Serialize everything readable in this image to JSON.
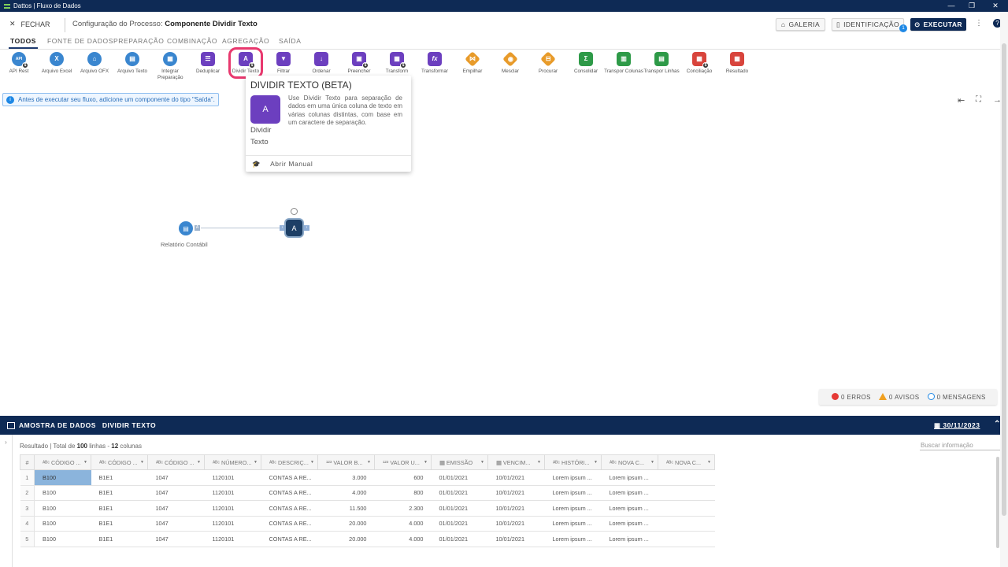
{
  "window": {
    "title": "Dattos | Fluxo de Dados",
    "minimize": "—",
    "restore": "❐",
    "close": "✕"
  },
  "header": {
    "close_label": "FECHAR",
    "process_label": "Configuração do Processo:",
    "process_name": "Componente Dividir Texto",
    "gallery": "GALERIA",
    "identification": "IDENTIFICAÇÃO",
    "identification_badge": "1",
    "execute": "EXECUTAR",
    "more": "⋮",
    "help": "?"
  },
  "tabs": [
    {
      "label": "TODOS",
      "active": true
    },
    {
      "label": "FONTE DE DADOS"
    },
    {
      "label": "PREPARAÇÃO"
    },
    {
      "label": "COMBINAÇÃO"
    },
    {
      "label": "AGREGAÇÃO"
    },
    {
      "label": "SAÍDA"
    }
  ],
  "tools": [
    {
      "label": "API Rest",
      "icon": "api-icon",
      "glyph": "API"
    },
    {
      "label": "Arquivo Excel",
      "icon": "excel-file-icon",
      "glyph": "X"
    },
    {
      "label": "Arquivo OFX",
      "icon": "bank-icon",
      "glyph": "⌂"
    },
    {
      "label": "Arquivo Texto",
      "icon": "text-file-icon",
      "glyph": "▤"
    },
    {
      "label": "Integrar Preparação",
      "icon": "integrate-icon",
      "glyph": "▦"
    },
    {
      "label": "Deduplicar",
      "icon": "dedupe-icon",
      "glyph": "☰"
    },
    {
      "label": "Dividir Texto",
      "icon": "split-text-icon",
      "glyph": "A"
    },
    {
      "label": "Filtrar",
      "icon": "filter-icon",
      "glyph": "▼"
    },
    {
      "label": "Ordenar",
      "icon": "sort-icon",
      "glyph": "↓"
    },
    {
      "label": "Preencher",
      "icon": "fill-icon",
      "glyph": "▣"
    },
    {
      "label": "Transform",
      "icon": "transform-icon",
      "glyph": "▦"
    },
    {
      "label": "Transformar",
      "icon": "function-icon",
      "glyph": "fx"
    },
    {
      "label": "Empilhar",
      "icon": "stack-icon",
      "glyph": "⋈"
    },
    {
      "label": "Mesclar",
      "icon": "merge-icon",
      "glyph": "◉"
    },
    {
      "label": "Procurar",
      "icon": "lookup-icon",
      "glyph": "⊟"
    },
    {
      "label": "Consolidar",
      "icon": "sum-icon",
      "glyph": "Σ"
    },
    {
      "label": "Transpor Colunas",
      "icon": "transpose-columns-icon",
      "glyph": "▥"
    },
    {
      "label": "Transpor Linhas",
      "icon": "transpose-rows-icon",
      "glyph": "▤"
    },
    {
      "label": "Conciliação",
      "icon": "reconcile-icon",
      "glyph": "▦"
    },
    {
      "label": "Resultado",
      "icon": "result-icon",
      "glyph": "▦"
    }
  ],
  "info_message": "Antes de executar seu fluxo, adicione um componente do tipo \"Saída\".",
  "tooltip": {
    "title": "DIVIDIR TEXTO (BETA)",
    "description": "Use Dividir Texto para separação de dados em uma única coluna de texto em várias colunas distintas, com base em um caractere de separação.",
    "name_line1": "Dividir",
    "name_line2": "Texto",
    "manual": "Abrir Manual"
  },
  "canvas": {
    "node_source_label": "Relatório Contábil",
    "port_a": "A",
    "port_in": "›",
    "port_out": "›"
  },
  "canvas_controls": {
    "collapse": "⇤",
    "fit": "⛶",
    "expand": "→"
  },
  "status": {
    "errors": "0 ERROS",
    "warnings": "0 AVISOS",
    "messages": "0 MENSAGENS"
  },
  "panel": {
    "title": "AMOSTRA DE DADOS",
    "subtitle": "DIVIDIR TEXTO",
    "date": "30/11/2023",
    "toggle": "⌃",
    "side_arrow": "›",
    "search_placeholder": "Buscar informação",
    "search_icon": "C"
  },
  "summary": {
    "prefix": "Resultado | Total de ",
    "rows": "100",
    "mid": " linhas - ",
    "cols": "12",
    "suffix": " colunas"
  },
  "table": {
    "headers": [
      "#",
      "ᴬᴮᶜ CÓDIGO ...",
      "ᴬᴮᶜ CÓDIGO ...",
      "ᴬᴮᶜ CÓDIGO ...",
      "ᴬᴮᶜ NÚMERO...",
      "ᴬᴮᶜ DESCRIÇ...",
      "¹²³ VALOR B...",
      "¹²³ VALOR U...",
      "▦ EMISSÃO",
      "▦ VENCIM...",
      "ᴬᴮᶜ HISTÓRI...",
      "ᴬᴮᶜ NOVA C...",
      "ᴬᴮᶜ NOVA C..."
    ],
    "rows": [
      [
        "1",
        "B100",
        "B1E1",
        "1047",
        "1120101",
        "CONTAS A RE...",
        "3.000",
        "600",
        "01/01/2021",
        "10/01/2021",
        "Lorem ipsum ...",
        "Lorem ipsum ...",
        ""
      ],
      [
        "2",
        "B100",
        "B1E1",
        "1047",
        "1120101",
        "CONTAS A RE...",
        "4.000",
        "800",
        "01/01/2021",
        "10/01/2021",
        "Lorem ipsum ...",
        "Lorem ipsum ...",
        ""
      ],
      [
        "3",
        "B100",
        "B1E1",
        "1047",
        "1120101",
        "CONTAS A RE...",
        "11.500",
        "2.300",
        "01/01/2021",
        "10/01/2021",
        "Lorem ipsum ...",
        "Lorem ipsum ...",
        ""
      ],
      [
        "4",
        "B100",
        "B1E1",
        "1047",
        "1120101",
        "CONTAS A RE...",
        "20.000",
        "4.000",
        "01/01/2021",
        "10/01/2021",
        "Lorem ipsum ...",
        "Lorem ipsum ...",
        ""
      ],
      [
        "5",
        "B100",
        "B1E1",
        "1047",
        "1120101",
        "CONTAS A RE...",
        "20.000",
        "4.000",
        "01/01/2021",
        "10/01/2021",
        "Lorem ipsum ...",
        "Lorem ipsum ...",
        ""
      ]
    ]
  }
}
